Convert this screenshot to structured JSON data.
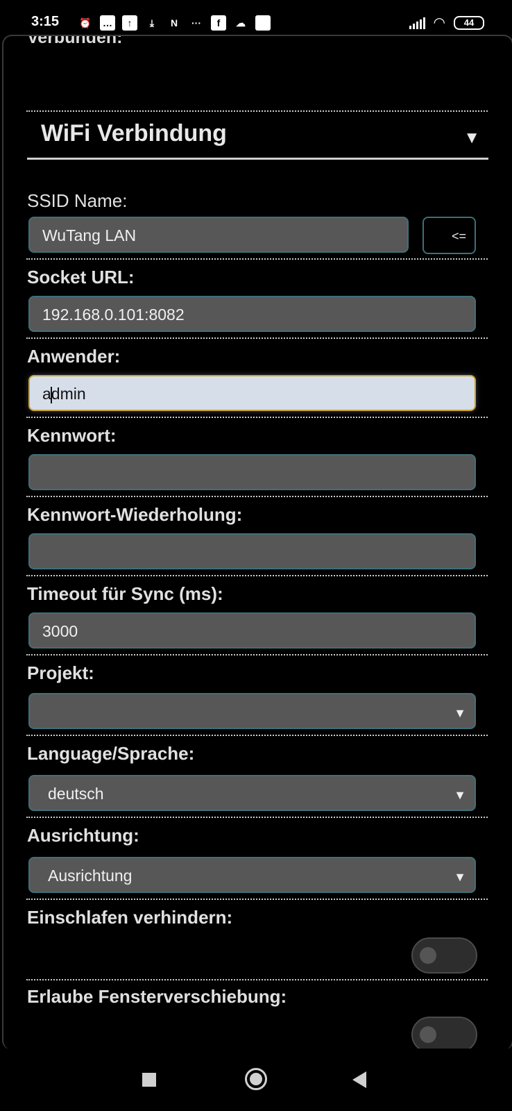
{
  "status_bar": {
    "time": "3:15",
    "battery": "44",
    "icons": [
      "alarm-icon",
      "message-icon",
      "upload-icon",
      "download-icon",
      "netflix-icon",
      "more-icon",
      "facebook-icon",
      "cloud-icon",
      "app-icon",
      "signal-icon",
      "wifi-icon",
      "battery-icon"
    ]
  },
  "form": {
    "connected_label": "Verbunden:",
    "section_title": "WiFi Verbindung",
    "section_arrow": "▼",
    "ssid": {
      "label": "SSID Name:",
      "value": "WuTang LAN",
      "button": "<="
    },
    "socket_url": {
      "label": "Socket URL:",
      "value": "192.168.0.101:8082"
    },
    "user": {
      "label": "Anwender:",
      "value_before_caret": "a",
      "value_after_caret": "dmin"
    },
    "password": {
      "label": "Kennwort:",
      "value": ""
    },
    "password_repeat": {
      "label": "Kennwort-Wiederholung:",
      "value": ""
    },
    "timeout": {
      "label": "Timeout für Sync (ms):",
      "value": "3000"
    },
    "project": {
      "label": "Projekt:",
      "value": ""
    },
    "language": {
      "label": "Language/Sprache:",
      "value": "deutsch"
    },
    "orientation": {
      "label": "Ausrichtung:",
      "value": "Ausrichtung"
    },
    "prevent_sleep": {
      "label": "Einschlafen verhindern:",
      "on": false
    },
    "allow_window_move": {
      "label": "Erlaube Fensterverschiebung:",
      "on": false
    },
    "select_arrow": "▼"
  },
  "colors": {
    "background": "#000000",
    "field_bg": "#575757",
    "field_border": "#3f6f78",
    "focused_bg": "#d6deea",
    "focused_border": "#c9a227"
  }
}
